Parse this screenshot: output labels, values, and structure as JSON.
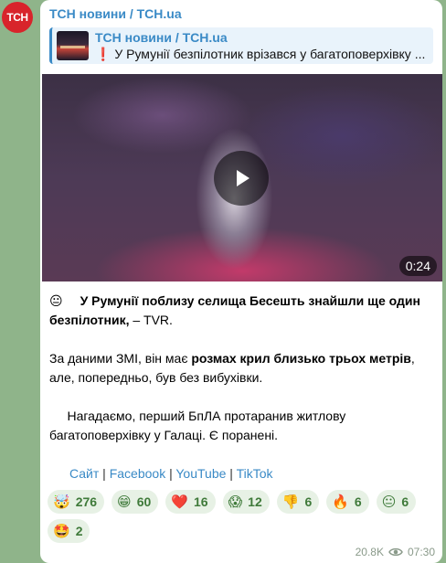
{
  "avatar_text": "ТСН",
  "channel_name": "ТСН новини / TCH.ua",
  "reply": {
    "title": "ТСН новини / TCH.ua",
    "mark": "❗",
    "text": " У Румунії безпілотник врізався у багатоповерхівку ..."
  },
  "video": {
    "duration": "0:24"
  },
  "message": {
    "p1_emoji": "😐",
    "p1_bold": "У Румунії поблизу селища Бесешть знайшли ще один безпілотник,",
    "p1_tail": " – TVR.",
    "p2_start": "За даними ЗМІ, він має ",
    "p2_bold": "розмах крил близько трьох метрів",
    "p2_end": ", але, попередньо, був без вибухівки.",
    "p3": "Нагадаємо, перший БпЛА протаранив житлову багатоповерхівку у Галаці. Є поранені."
  },
  "links": [
    "Сайт",
    "Facebook",
    "YouTube",
    "TikTok"
  ],
  "link_separator": " | ",
  "reactions": [
    {
      "emoji": "🤯",
      "count": "276"
    },
    {
      "emoji": "😁",
      "count": "60"
    },
    {
      "emoji": "❤️",
      "count": "16"
    },
    {
      "emoji": "😱",
      "count": "12"
    },
    {
      "emoji": "👎",
      "count": "6"
    },
    {
      "emoji": "🔥",
      "count": "6"
    },
    {
      "emoji": "😐",
      "count": "6"
    },
    {
      "emoji": "🤩",
      "count": "2"
    }
  ],
  "views": "20.8K",
  "time": "07:30",
  "colors": {
    "accent": "#3a8ac6",
    "avatar": "#d8242b",
    "background": "#8fb48a"
  },
  "icons": {
    "play": "play-icon",
    "views": "eye-icon"
  }
}
